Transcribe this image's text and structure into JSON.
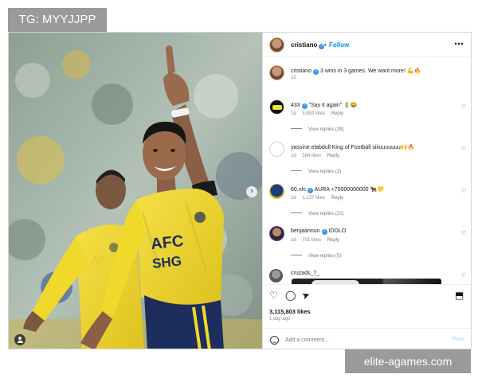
{
  "overlays": {
    "top_left": "TG: MYYJJPP",
    "bottom_right": "elite-agames.com"
  },
  "photo": {
    "jersey_lines": [
      "AFC",
      "SHG"
    ]
  },
  "header": {
    "username": "cristiano",
    "separator": "•",
    "follow_label": "Follow",
    "more_icon": "⋯"
  },
  "caption": {
    "username": "cristiano",
    "text": "3 wins in 3 games. We want more! 💪🔥",
    "time": "1d"
  },
  "comments": [
    {
      "username": "433",
      "verified": true,
      "text": "\"Say it again\" 🔋😂",
      "time": "1d",
      "likes": "5,852 likes",
      "reply": "Reply",
      "view_replies": "View replies (39)",
      "avatar_color": "#111111",
      "avatar_accent": "#e8e53a"
    },
    {
      "username": "yassine.elabdull",
      "verified": false,
      "text": "King of Football siiiuuuuuuu🙌🔥",
      "time": "1d",
      "likes": "584 likes",
      "reply": "Reply",
      "view_replies": "View replies (3)",
      "avatar_color": "#ffffff",
      "avatar_accent": "#e7c4d6"
    },
    {
      "username": "60.nfc",
      "verified": true,
      "text": "AURA +70000000000 🐂💛",
      "time": "1d",
      "likes": "1,137 likes",
      "reply": "Reply",
      "view_replies": "View replies (22)",
      "avatar_color": "#1a3d7c",
      "avatar_accent": "#d9b233"
    },
    {
      "username": "benjaannun",
      "verified": true,
      "text": "IDOLO",
      "time": "1d",
      "likes": "701 likes",
      "reply": "Reply",
      "view_replies": "View replies (5)",
      "avatar_color": "#2b2b2b",
      "avatar_accent": "#b88a6e"
    },
    {
      "username": "cruzads_7_",
      "verified": false,
      "text": "",
      "time": "",
      "likes": "",
      "reply": "",
      "view_replies": "",
      "avatar_color": "#5a5a5a",
      "avatar_accent": "#9a9a9a"
    }
  ],
  "actions": {
    "heart_icon": "♡",
    "comment_icon": "◯",
    "share_icon": "➤",
    "bookmark_icon": "⬒",
    "likes": "3,115,803 likes",
    "time_ago": "1 day ago",
    "comment_placeholder": "Add a comment...",
    "post_label": "Post"
  },
  "icons": {
    "heart": "♡",
    "next": "›"
  },
  "colors": {
    "accent": "#0095f6",
    "verified": "#3897f0",
    "jersey": "#f1d92c",
    "shorts": "#1d2d5e"
  }
}
